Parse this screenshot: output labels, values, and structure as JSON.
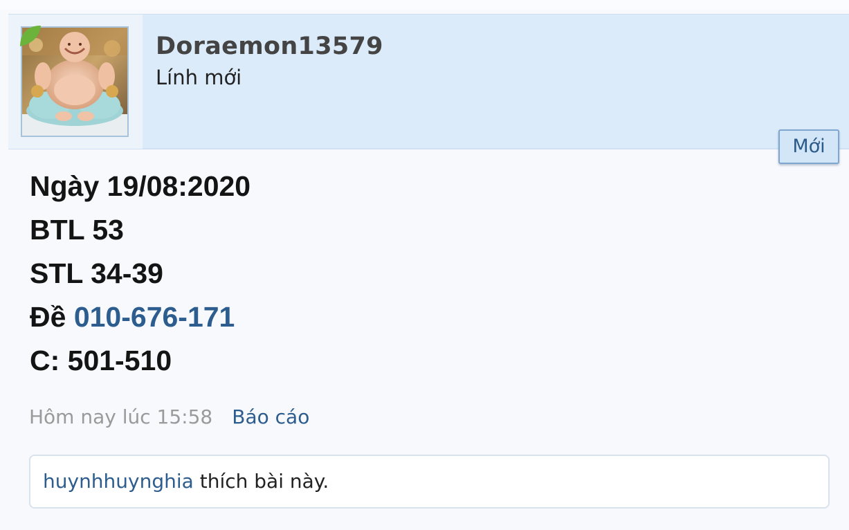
{
  "post": {
    "author": {
      "username": "Doraemon13579",
      "rank": "Lính mới",
      "avatar_icon": "avatar-laughing-buddha-statue"
    },
    "new_badge": "Mới",
    "content": {
      "line1": "Ngày 19/08:2020",
      "line2": "BTL 53",
      "line3": "STL 34-39",
      "line4_prefix": "Đề",
      "line4_link": "010-676-171",
      "line5": "C: 501-510"
    },
    "meta": {
      "timestamp": "Hôm nay lúc 15:58",
      "report_label": "Báo cáo"
    },
    "likes": {
      "user": "huynhhuynghia",
      "text": "thích bài này."
    }
  },
  "colors": {
    "header_bg": "#dbebf9",
    "link_blue": "#2d5d8e",
    "badge_border": "#7fa6cf",
    "leaf_green": "#6bb33a"
  }
}
